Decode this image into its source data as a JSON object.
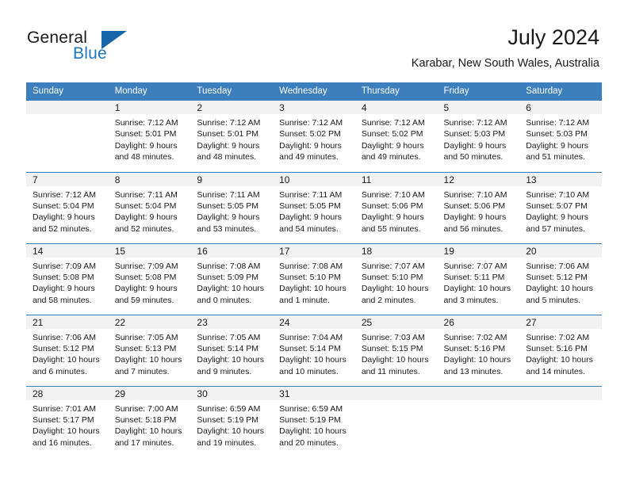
{
  "logo": {
    "word_one": "General",
    "word_two": "Blue",
    "triangle_icon": "triangle-icon"
  },
  "header": {
    "title": "July 2024",
    "location": "Karabar, New South Wales, Australia"
  },
  "colors": {
    "header_blue": "#3d7ebd",
    "logo_blue": "#2176bd",
    "daynum_band": "#f2f2f2",
    "text": "#1a1a1a"
  },
  "weekdays": [
    "Sunday",
    "Monday",
    "Tuesday",
    "Wednesday",
    "Thursday",
    "Friday",
    "Saturday"
  ],
  "labels": {
    "sunrise_prefix": "Sunrise:",
    "sunset_prefix": "Sunset:",
    "daylight_prefix": "Daylight:"
  },
  "weeks": [
    [
      {
        "day": "",
        "sunrise": "",
        "sunset": "",
        "daylight_line1": "",
        "daylight_line2": ""
      },
      {
        "day": "1",
        "sunrise": "Sunrise: 7:12 AM",
        "sunset": "Sunset: 5:01 PM",
        "daylight_line1": "Daylight: 9 hours",
        "daylight_line2": "and 48 minutes."
      },
      {
        "day": "2",
        "sunrise": "Sunrise: 7:12 AM",
        "sunset": "Sunset: 5:01 PM",
        "daylight_line1": "Daylight: 9 hours",
        "daylight_line2": "and 48 minutes."
      },
      {
        "day": "3",
        "sunrise": "Sunrise: 7:12 AM",
        "sunset": "Sunset: 5:02 PM",
        "daylight_line1": "Daylight: 9 hours",
        "daylight_line2": "and 49 minutes."
      },
      {
        "day": "4",
        "sunrise": "Sunrise: 7:12 AM",
        "sunset": "Sunset: 5:02 PM",
        "daylight_line1": "Daylight: 9 hours",
        "daylight_line2": "and 49 minutes."
      },
      {
        "day": "5",
        "sunrise": "Sunrise: 7:12 AM",
        "sunset": "Sunset: 5:03 PM",
        "daylight_line1": "Daylight: 9 hours",
        "daylight_line2": "and 50 minutes."
      },
      {
        "day": "6",
        "sunrise": "Sunrise: 7:12 AM",
        "sunset": "Sunset: 5:03 PM",
        "daylight_line1": "Daylight: 9 hours",
        "daylight_line2": "and 51 minutes."
      }
    ],
    [
      {
        "day": "7",
        "sunrise": "Sunrise: 7:12 AM",
        "sunset": "Sunset: 5:04 PM",
        "daylight_line1": "Daylight: 9 hours",
        "daylight_line2": "and 52 minutes."
      },
      {
        "day": "8",
        "sunrise": "Sunrise: 7:11 AM",
        "sunset": "Sunset: 5:04 PM",
        "daylight_line1": "Daylight: 9 hours",
        "daylight_line2": "and 52 minutes."
      },
      {
        "day": "9",
        "sunrise": "Sunrise: 7:11 AM",
        "sunset": "Sunset: 5:05 PM",
        "daylight_line1": "Daylight: 9 hours",
        "daylight_line2": "and 53 minutes."
      },
      {
        "day": "10",
        "sunrise": "Sunrise: 7:11 AM",
        "sunset": "Sunset: 5:05 PM",
        "daylight_line1": "Daylight: 9 hours",
        "daylight_line2": "and 54 minutes."
      },
      {
        "day": "11",
        "sunrise": "Sunrise: 7:10 AM",
        "sunset": "Sunset: 5:06 PM",
        "daylight_line1": "Daylight: 9 hours",
        "daylight_line2": "and 55 minutes."
      },
      {
        "day": "12",
        "sunrise": "Sunrise: 7:10 AM",
        "sunset": "Sunset: 5:06 PM",
        "daylight_line1": "Daylight: 9 hours",
        "daylight_line2": "and 56 minutes."
      },
      {
        "day": "13",
        "sunrise": "Sunrise: 7:10 AM",
        "sunset": "Sunset: 5:07 PM",
        "daylight_line1": "Daylight: 9 hours",
        "daylight_line2": "and 57 minutes."
      }
    ],
    [
      {
        "day": "14",
        "sunrise": "Sunrise: 7:09 AM",
        "sunset": "Sunset: 5:08 PM",
        "daylight_line1": "Daylight: 9 hours",
        "daylight_line2": "and 58 minutes."
      },
      {
        "day": "15",
        "sunrise": "Sunrise: 7:09 AM",
        "sunset": "Sunset: 5:08 PM",
        "daylight_line1": "Daylight: 9 hours",
        "daylight_line2": "and 59 minutes."
      },
      {
        "day": "16",
        "sunrise": "Sunrise: 7:08 AM",
        "sunset": "Sunset: 5:09 PM",
        "daylight_line1": "Daylight: 10 hours",
        "daylight_line2": "and 0 minutes."
      },
      {
        "day": "17",
        "sunrise": "Sunrise: 7:08 AM",
        "sunset": "Sunset: 5:10 PM",
        "daylight_line1": "Daylight: 10 hours",
        "daylight_line2": "and 1 minute."
      },
      {
        "day": "18",
        "sunrise": "Sunrise: 7:07 AM",
        "sunset": "Sunset: 5:10 PM",
        "daylight_line1": "Daylight: 10 hours",
        "daylight_line2": "and 2 minutes."
      },
      {
        "day": "19",
        "sunrise": "Sunrise: 7:07 AM",
        "sunset": "Sunset: 5:11 PM",
        "daylight_line1": "Daylight: 10 hours",
        "daylight_line2": "and 3 minutes."
      },
      {
        "day": "20",
        "sunrise": "Sunrise: 7:06 AM",
        "sunset": "Sunset: 5:12 PM",
        "daylight_line1": "Daylight: 10 hours",
        "daylight_line2": "and 5 minutes."
      }
    ],
    [
      {
        "day": "21",
        "sunrise": "Sunrise: 7:06 AM",
        "sunset": "Sunset: 5:12 PM",
        "daylight_line1": "Daylight: 10 hours",
        "daylight_line2": "and 6 minutes."
      },
      {
        "day": "22",
        "sunrise": "Sunrise: 7:05 AM",
        "sunset": "Sunset: 5:13 PM",
        "daylight_line1": "Daylight: 10 hours",
        "daylight_line2": "and 7 minutes."
      },
      {
        "day": "23",
        "sunrise": "Sunrise: 7:05 AM",
        "sunset": "Sunset: 5:14 PM",
        "daylight_line1": "Daylight: 10 hours",
        "daylight_line2": "and 9 minutes."
      },
      {
        "day": "24",
        "sunrise": "Sunrise: 7:04 AM",
        "sunset": "Sunset: 5:14 PM",
        "daylight_line1": "Daylight: 10 hours",
        "daylight_line2": "and 10 minutes."
      },
      {
        "day": "25",
        "sunrise": "Sunrise: 7:03 AM",
        "sunset": "Sunset: 5:15 PM",
        "daylight_line1": "Daylight: 10 hours",
        "daylight_line2": "and 11 minutes."
      },
      {
        "day": "26",
        "sunrise": "Sunrise: 7:02 AM",
        "sunset": "Sunset: 5:16 PM",
        "daylight_line1": "Daylight: 10 hours",
        "daylight_line2": "and 13 minutes."
      },
      {
        "day": "27",
        "sunrise": "Sunrise: 7:02 AM",
        "sunset": "Sunset: 5:16 PM",
        "daylight_line1": "Daylight: 10 hours",
        "daylight_line2": "and 14 minutes."
      }
    ],
    [
      {
        "day": "28",
        "sunrise": "Sunrise: 7:01 AM",
        "sunset": "Sunset: 5:17 PM",
        "daylight_line1": "Daylight: 10 hours",
        "daylight_line2": "and 16 minutes."
      },
      {
        "day": "29",
        "sunrise": "Sunrise: 7:00 AM",
        "sunset": "Sunset: 5:18 PM",
        "daylight_line1": "Daylight: 10 hours",
        "daylight_line2": "and 17 minutes."
      },
      {
        "day": "30",
        "sunrise": "Sunrise: 6:59 AM",
        "sunset": "Sunset: 5:19 PM",
        "daylight_line1": "Daylight: 10 hours",
        "daylight_line2": "and 19 minutes."
      },
      {
        "day": "31",
        "sunrise": "Sunrise: 6:59 AM",
        "sunset": "Sunset: 5:19 PM",
        "daylight_line1": "Daylight: 10 hours",
        "daylight_line2": "and 20 minutes."
      },
      {
        "day": "",
        "sunrise": "",
        "sunset": "",
        "daylight_line1": "",
        "daylight_line2": ""
      },
      {
        "day": "",
        "sunrise": "",
        "sunset": "",
        "daylight_line1": "",
        "daylight_line2": ""
      },
      {
        "day": "",
        "sunrise": "",
        "sunset": "",
        "daylight_line1": "",
        "daylight_line2": ""
      }
    ]
  ]
}
